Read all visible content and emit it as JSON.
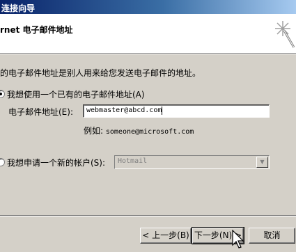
{
  "window": {
    "title": "连接向导"
  },
  "header": {
    "title": "rnet 电子邮件地址"
  },
  "description": "的电子邮件地址是别人用来给您发送电子邮件的地址。",
  "options": {
    "existing": {
      "label": "我想使用一个已有的电子邮件地址(A)",
      "selected": true
    },
    "new": {
      "label": "我想申请一个新的帐户(S):",
      "selected": false
    }
  },
  "email": {
    "label": "电子邮件地址(E):",
    "value": "webmaster@abcd.com",
    "example_prefix": "例如:",
    "example_value": "someone@microsoft.com"
  },
  "provider_select": {
    "value": "Hotmail",
    "disabled": true
  },
  "buttons": {
    "back": "< 上一步(B)",
    "next": "下一步(N) >",
    "cancel": "取消"
  }
}
